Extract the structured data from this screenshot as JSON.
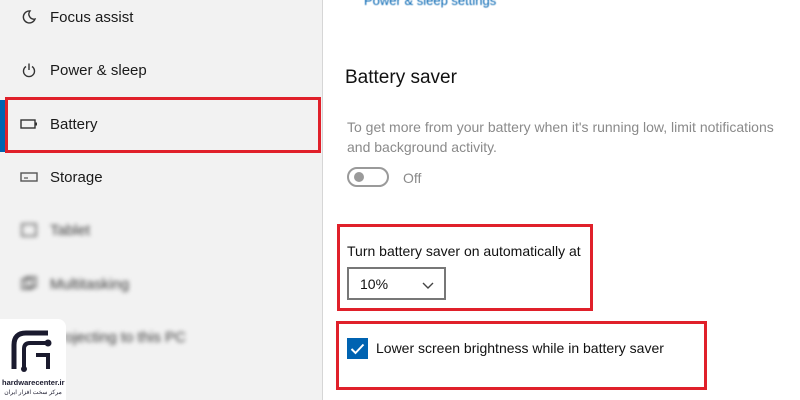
{
  "sidebar": {
    "items": [
      {
        "label": "Focus assist",
        "icon": "moon-icon"
      },
      {
        "label": "Power & sleep",
        "icon": "power-icon"
      },
      {
        "label": "Battery",
        "icon": "battery-icon"
      },
      {
        "label": "Storage",
        "icon": "storage-icon"
      },
      {
        "label": "Tablet",
        "icon": "tablet-icon"
      },
      {
        "label": "Multitasking",
        "icon": "multitasking-icon"
      },
      {
        "label": "Projecting to this PC",
        "icon": "projector-icon"
      }
    ],
    "active_item": "Battery"
  },
  "main": {
    "top_link": "Power & sleep settings",
    "section_title": "Battery saver",
    "description": "To get more from your battery when it's running low, limit notifications and background activity.",
    "toggle": {
      "state_label": "Off",
      "on": false
    },
    "auto_label": "Turn battery saver on automatically at",
    "auto_select": {
      "value": "10%"
    },
    "brightness_checkbox": {
      "label": "Lower screen brightness while in battery saver",
      "checked": true
    }
  },
  "watermark": {
    "text": "hardwarecenter.ir",
    "subtext": "مرکز سخت افزار ایران"
  },
  "colors": {
    "accent": "#0063b1",
    "highlight_box": "#e0202a"
  }
}
